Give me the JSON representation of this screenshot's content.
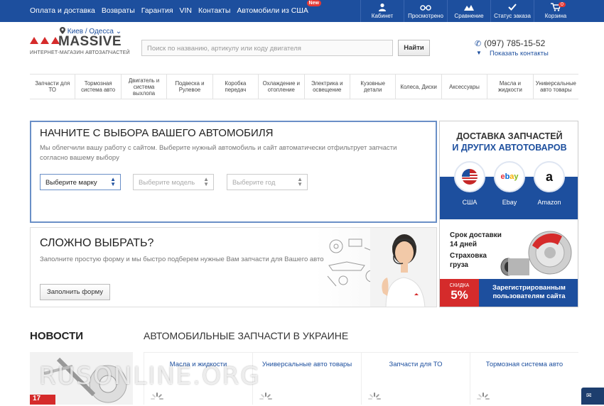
{
  "topnav": {
    "links": [
      "Оплата и доставка",
      "Возвраты",
      "Гарантия",
      "VIN",
      "Контакты",
      "Автомобили из США"
    ],
    "new_badge": "New"
  },
  "topicons": [
    {
      "label": "Кабинет",
      "icon": "user-icon"
    },
    {
      "label": "Просмотрено",
      "icon": "glasses-icon"
    },
    {
      "label": "Сравнение",
      "icon": "scale-icon"
    },
    {
      "label": "Статус заказа",
      "icon": "check-icon"
    },
    {
      "label": "Корзина",
      "icon": "cart-icon",
      "count": "0"
    }
  ],
  "header": {
    "logo_name": "MASSIVE",
    "logo_tagline": "ИНТЕРНЕТ-МАГАЗИН АВТОЗАПЧАСТЕЙ",
    "city": "Киев / Одесса",
    "search_placeholder": "Поиск по названию, артикулу или коду двигателя",
    "search_button": "Найти",
    "phone": "(097) 785-15-52",
    "show_contacts": "Показать контакты"
  },
  "categories": [
    "Запчасти для ТО",
    "Тормозная система авто",
    "Двигатель и система выхлопа",
    "Подвеска и Рулевое",
    "Коробка передач",
    "Охлаждение и отопление",
    "Электрика и освещение",
    "Кузовные детали",
    "Колеса, Диски",
    "Аксессуары",
    "Масла и жидкости",
    "Универсальные авто товары"
  ],
  "picker": {
    "title": "НАЧНИТЕ С ВЫБОРА ВАШЕГО АВТОМОБИЛЯ",
    "text": "Мы облегчили вашу работу с сайтом. Выберите нужный автомобиль и сайт автоматически отфильтрует запчасти согласно вашему выбору",
    "brand": "Выберите марку",
    "model": "Выберите модель",
    "year": "Выберите год"
  },
  "hard": {
    "title": "СЛОЖНО ВЫБРАТЬ?",
    "text": "Заполните простую форму и мы быстро подберем нужные Вам запчасти для Вашего авто",
    "button": "Заполнить форму"
  },
  "promo": {
    "title1": "ДОСТАВКА ЗАПЧАСТЕЙ",
    "title2": "И ДРУГИХ АВТОТОВАРОВ",
    "shops": [
      "США",
      "Ebay",
      "Amazon"
    ],
    "delivery_l1": "Срок доставки",
    "delivery_l2": "14 дней",
    "insurance_l1": "Страховка",
    "insurance_l2": "груза",
    "discount_word": "СКИДКА",
    "discount_value": "5%",
    "registered": "Зарегистрированным пользователям сайта",
    "colors": {
      "brand_blue": "#1d4f9e",
      "accent_red": "#d52b2b"
    }
  },
  "news": {
    "title": "НОВОСТИ",
    "date": "17"
  },
  "catalog": {
    "title": "АВТОМОБИЛЬНЫЕ ЗАПЧАСТИ В УКРАИНЕ",
    "tiles": [
      "Масла и жидкости",
      "Универсальные авто товары",
      "Запчасти для ТО",
      "Тормозная система авто"
    ]
  },
  "watermark": "RUSONLINE.ORG"
}
